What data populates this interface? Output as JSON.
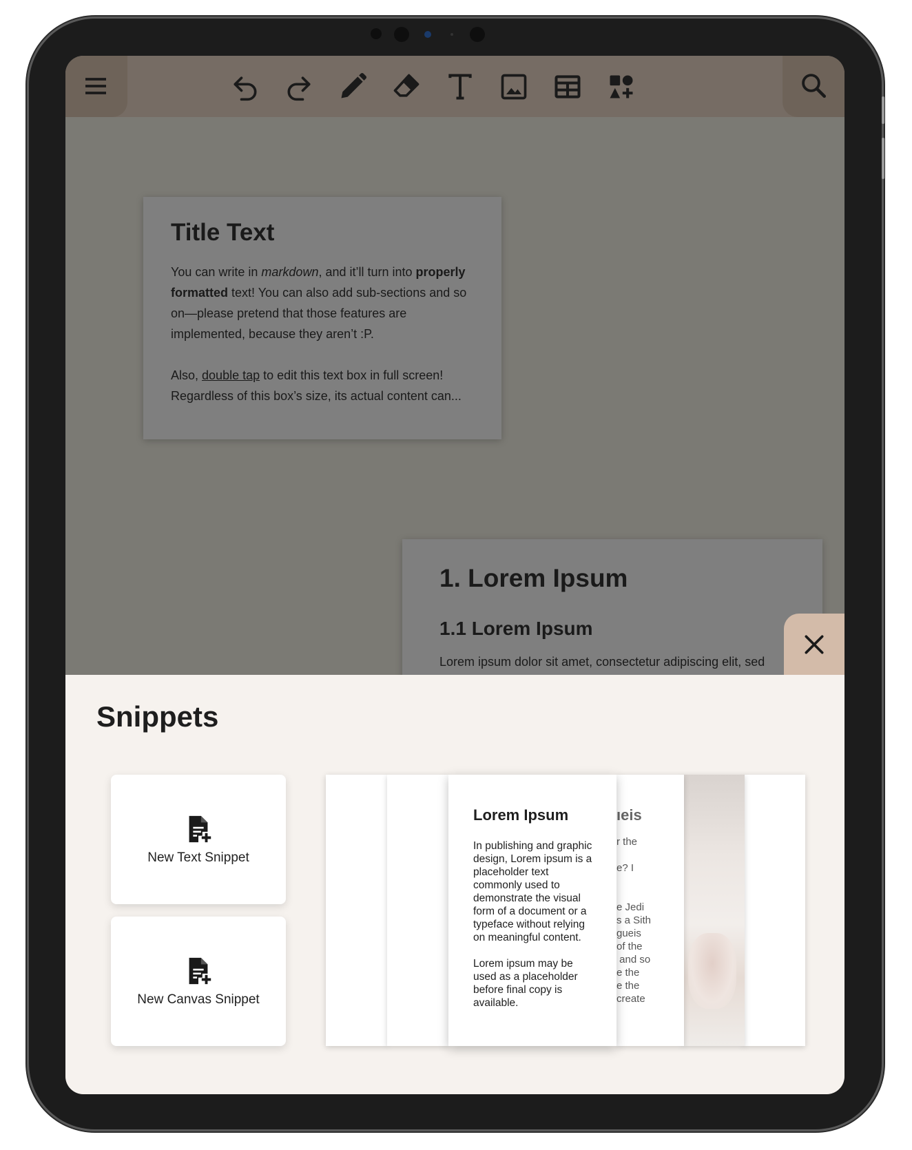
{
  "toolbar": {
    "menu_icon": "hamburger-menu-icon",
    "tools": [
      "undo-icon",
      "redo-icon",
      "pen-icon",
      "eraser-icon",
      "text-icon",
      "image-icon",
      "table-icon",
      "shapes-add-icon"
    ],
    "search_icon": "search-icon"
  },
  "canvas": {
    "card1": {
      "title": "Title Text",
      "p1_a": "You can write in ",
      "p1_em": "markdown",
      "p1_b": ", and it’ll turn into ",
      "p1_strong": "properly formatted",
      "p1_c": " text! You can also add sub-sections and so on—please pretend that those features are implemented, because they aren’t :P.",
      "p2_a": "Also, ",
      "p2_link": "double tap",
      "p2_b": " to edit this text box in full screen! Regardless of this box’s size, its actual content can..."
    },
    "card2": {
      "heading": "1. Lorem Ipsum",
      "subheading": "1.1 Lorem Ipsum",
      "body": "Lorem ipsum dolor sit amet, consectetur adipiscing elit, sed"
    }
  },
  "snippets": {
    "title": "Snippets",
    "close_icon": "close-icon",
    "new_text_label": "New Text Snippet",
    "new_canvas_label": "New Canvas Snippet",
    "front_card": {
      "title": "Lorem Ipsum",
      "para1": "In publishing and graphic design, Lorem ipsum is a placeholder text commonly used to demonstrate the visual form of a document or a typeface without relying on meaningful content.",
      "para2": "Lorem ipsum may be used as a placeholder before final copy is available."
    },
    "peek_card": {
      "title": "ıeis",
      "lines": [
        "r the",
        "",
        "e? I",
        "",
        "",
        "e Jedi",
        "s a Sith",
        "gueis",
        "of the",
        " and so",
        "e the",
        "e the",
        "create"
      ]
    }
  },
  "colors": {
    "device_frame": "#1c1c1c",
    "toolbar": "#766c64",
    "canvas_dim": "#7b7a74",
    "panel": "#f6f2ee",
    "close_tab": "#d3bba9"
  }
}
